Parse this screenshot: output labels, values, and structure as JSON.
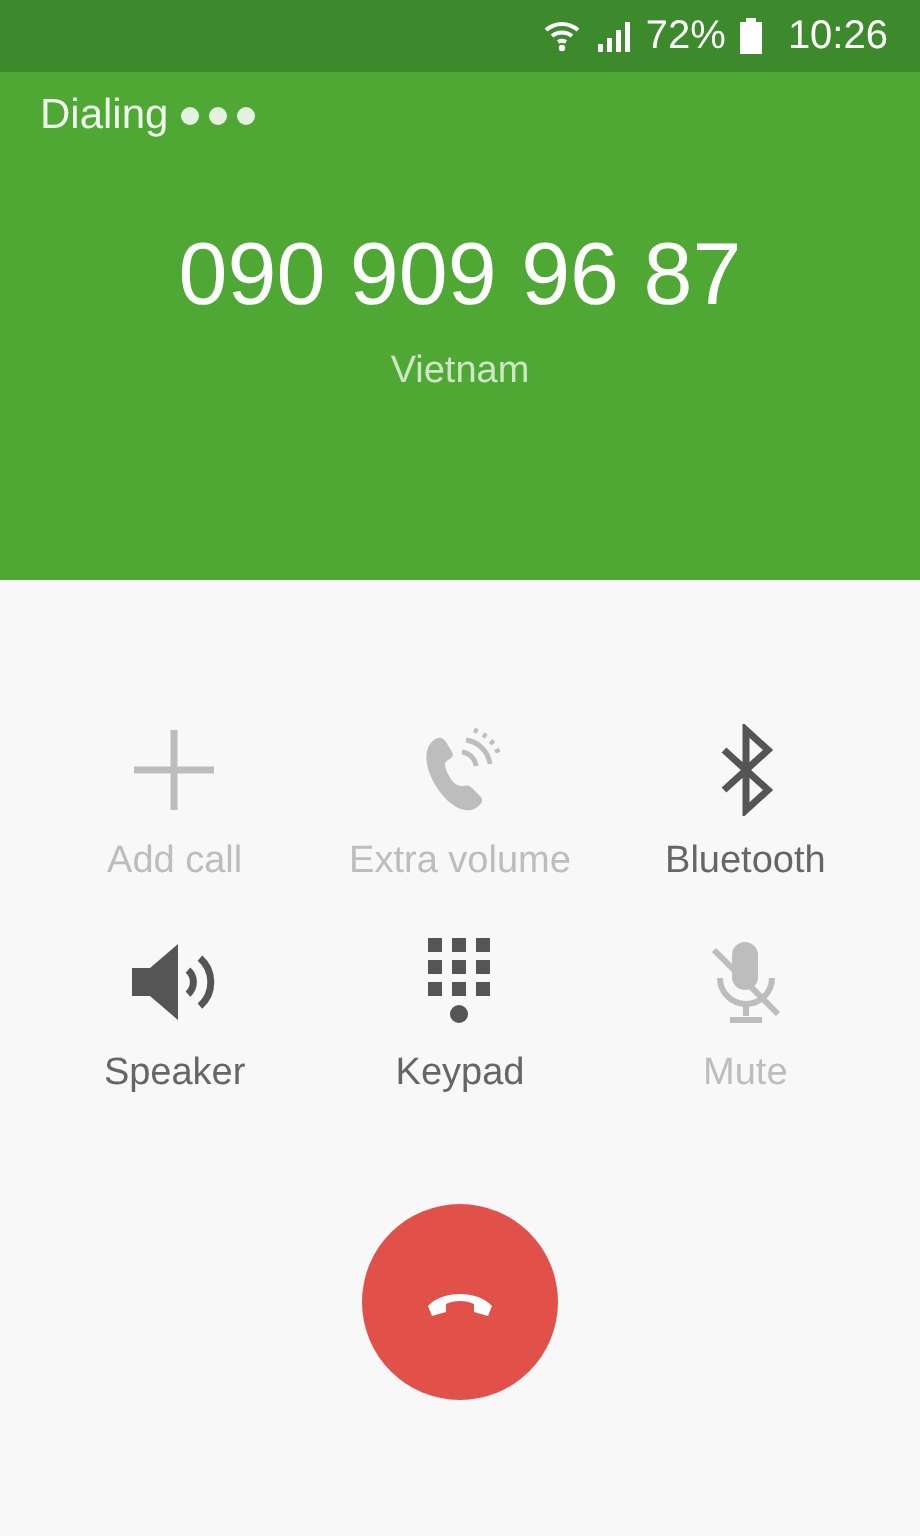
{
  "status_bar": {
    "battery": "72%",
    "time": "10:26"
  },
  "call": {
    "state": "Dialing",
    "number": "090 909 96 87",
    "location": "Vietnam"
  },
  "actions": [
    {
      "kind": "add",
      "label": "Add call",
      "disabled": true
    },
    {
      "kind": "volume",
      "label": "Extra volume",
      "disabled": true
    },
    {
      "kind": "bluetooth",
      "label": "Bluetooth",
      "disabled": false
    },
    {
      "kind": "speaker",
      "label": "Speaker",
      "disabled": false
    },
    {
      "kind": "keypad",
      "label": "Keypad",
      "disabled": false
    },
    {
      "kind": "mute",
      "label": "Mute",
      "disabled": true
    }
  ]
}
